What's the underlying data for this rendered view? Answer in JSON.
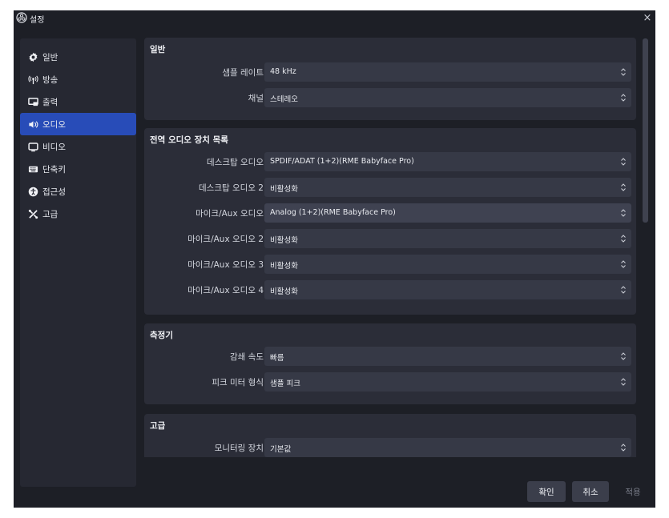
{
  "window": {
    "title": "설정",
    "close_icon": "×"
  },
  "sidebar": {
    "items": [
      {
        "label": "일반",
        "icon": "gear-icon",
        "active": false
      },
      {
        "label": "방송",
        "icon": "antenna-icon",
        "active": false
      },
      {
        "label": "출력",
        "icon": "output-icon",
        "active": false
      },
      {
        "label": "오디오",
        "icon": "speaker-icon",
        "active": true
      },
      {
        "label": "비디오",
        "icon": "monitor-icon",
        "active": false
      },
      {
        "label": "단축키",
        "icon": "keyboard-icon",
        "active": false
      },
      {
        "label": "접근성",
        "icon": "accessibility-icon",
        "active": false
      },
      {
        "label": "고급",
        "icon": "tools-icon",
        "active": false
      }
    ]
  },
  "sections": {
    "general": {
      "title": "일반",
      "rows": [
        {
          "label": "샘플 레이트",
          "value": "48 kHz"
        },
        {
          "label": "채널",
          "value": "스테레오"
        }
      ]
    },
    "global_devices": {
      "title": "전역 오디오 장치 목록",
      "rows": [
        {
          "label": "데스크탑 오디오",
          "value": "SPDIF/ADAT (1+2)(RME Babyface Pro)"
        },
        {
          "label": "데스크탑 오디오 2",
          "value": "비활성화"
        },
        {
          "label": "마이크/Aux 오디오",
          "value": "Analog (1+2)(RME Babyface Pro)"
        },
        {
          "label": "마이크/Aux 오디오 2",
          "value": "비활성화"
        },
        {
          "label": "마이크/Aux 오디오 3",
          "value": "비활성화"
        },
        {
          "label": "마이크/Aux 오디오 4",
          "value": "비활성화"
        }
      ]
    },
    "meters": {
      "title": "측정기",
      "rows": [
        {
          "label": "감쇄 속도",
          "value": "빠름"
        },
        {
          "label": "피크 미터 형식",
          "value": "샘플 피크"
        }
      ]
    },
    "advanced": {
      "title": "고급",
      "rows": [
        {
          "label": "모니터링 장치",
          "value": "기본값"
        }
      ]
    }
  },
  "footer": {
    "ok_label": "확인",
    "cancel_label": "취소",
    "apply_label": "적용"
  },
  "colors": {
    "background": "#1d1f26",
    "panel": "#2b2d38",
    "select": "#363946",
    "accent": "#284cb8"
  }
}
